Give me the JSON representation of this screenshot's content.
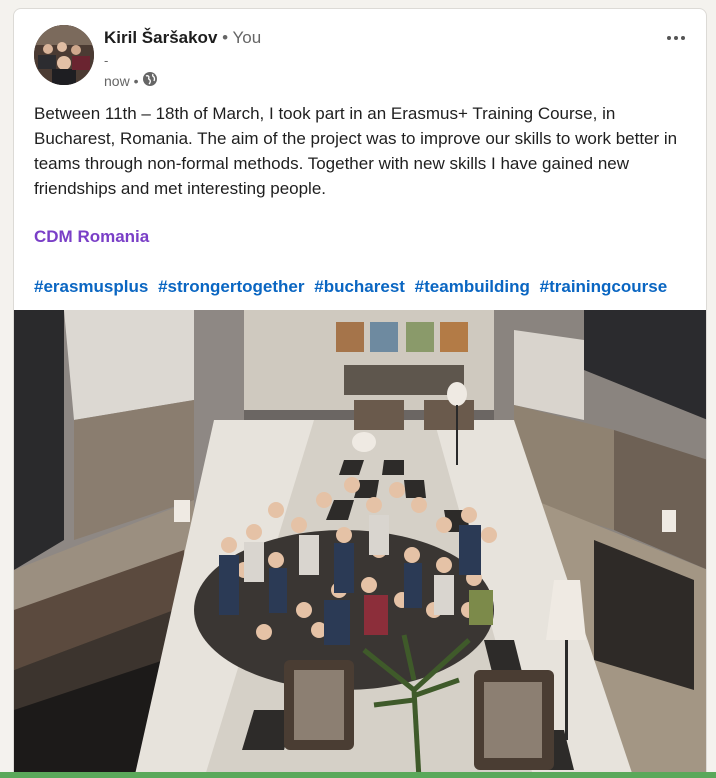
{
  "post": {
    "author_name": "Kiril Šaršakov",
    "author_relation": "• You",
    "author_subtitle": "-",
    "time": "now •",
    "visibility_icon": "globe-icon",
    "more_icon": "ellipsis-icon",
    "body": "Between 11th – 18th of March, I took part in an Erasmus+ Training Course, in Bucharest, Romania. The aim of the project was to improve our skills to work better in teams through non-formal methods. Together with new skills I have gained new friendships and met interesting people.",
    "mention": "CDM Romania",
    "hashtags": [
      "#erasmusplus",
      "#strongertogether",
      "#bucharest",
      "#teambuilding",
      "#trainingcourse"
    ]
  },
  "colors": {
    "hashtag": "#0a66c2",
    "mention": "#7a3fc7",
    "text": "#1f1f1f",
    "muted": "#666666"
  }
}
